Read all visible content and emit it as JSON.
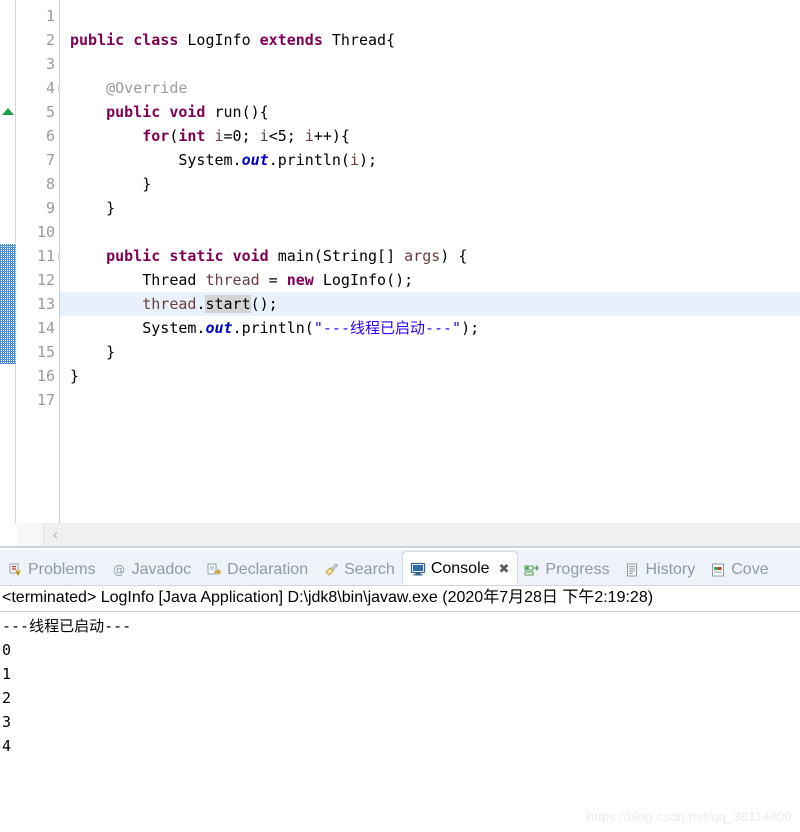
{
  "editor": {
    "line_numbers": [
      "1",
      "2",
      "3",
      "4",
      "5",
      "6",
      "7",
      "8",
      "9",
      "10",
      "11",
      "12",
      "13",
      "14",
      "15",
      "16",
      "17"
    ],
    "fold_lines": [
      4,
      11
    ],
    "marker_arrow_line": 5,
    "overview_hatch_lines": [
      11,
      12,
      13,
      14,
      15
    ],
    "highlighted_line": 13,
    "lines": [
      {
        "n": 1,
        "segments": []
      },
      {
        "n": 2,
        "segments": [
          {
            "t": "public ",
            "c": "kw"
          },
          {
            "t": "class ",
            "c": "kw"
          },
          {
            "t": "LogInfo ",
            "c": ""
          },
          {
            "t": "extends ",
            "c": "kw"
          },
          {
            "t": "Thread{",
            "c": ""
          }
        ]
      },
      {
        "n": 3,
        "segments": []
      },
      {
        "n": 4,
        "segments": [
          {
            "t": "    @Override",
            "c": "ann"
          }
        ]
      },
      {
        "n": 5,
        "segments": [
          {
            "t": "    ",
            "c": ""
          },
          {
            "t": "public ",
            "c": "kw"
          },
          {
            "t": "void ",
            "c": "kw"
          },
          {
            "t": "run(){",
            "c": ""
          }
        ]
      },
      {
        "n": 6,
        "segments": [
          {
            "t": "        ",
            "c": ""
          },
          {
            "t": "for",
            "c": "kw"
          },
          {
            "t": "(",
            "c": ""
          },
          {
            "t": "int ",
            "c": "kw"
          },
          {
            "t": "i",
            "c": "loc"
          },
          {
            "t": "=0; ",
            "c": ""
          },
          {
            "t": "i",
            "c": "loc"
          },
          {
            "t": "<5; ",
            "c": ""
          },
          {
            "t": "i",
            "c": "loc"
          },
          {
            "t": "++){",
            "c": ""
          }
        ]
      },
      {
        "n": 7,
        "segments": [
          {
            "t": "            System.",
            "c": ""
          },
          {
            "t": "out",
            "c": "fld"
          },
          {
            "t": ".println(",
            "c": ""
          },
          {
            "t": "i",
            "c": "loc"
          },
          {
            "t": ");",
            "c": ""
          }
        ]
      },
      {
        "n": 8,
        "segments": [
          {
            "t": "        }",
            "c": ""
          }
        ]
      },
      {
        "n": 9,
        "segments": [
          {
            "t": "    }",
            "c": ""
          }
        ]
      },
      {
        "n": 10,
        "segments": []
      },
      {
        "n": 11,
        "segments": [
          {
            "t": "    ",
            "c": ""
          },
          {
            "t": "public ",
            "c": "kw"
          },
          {
            "t": "static ",
            "c": "kw"
          },
          {
            "t": "void ",
            "c": "kw"
          },
          {
            "t": "main(String[] ",
            "c": ""
          },
          {
            "t": "args",
            "c": "loc"
          },
          {
            "t": ") {",
            "c": ""
          }
        ]
      },
      {
        "n": 12,
        "segments": [
          {
            "t": "        Thread ",
            "c": ""
          },
          {
            "t": "thread",
            "c": "loc"
          },
          {
            "t": " = ",
            "c": ""
          },
          {
            "t": "new ",
            "c": "kw"
          },
          {
            "t": "LogInfo();",
            "c": ""
          }
        ]
      },
      {
        "n": 13,
        "segments": [
          {
            "t": "        ",
            "c": ""
          },
          {
            "t": "thread",
            "c": "loc"
          },
          {
            "t": ".",
            "c": ""
          },
          {
            "t": "start",
            "c": "sel"
          },
          {
            "t": "();",
            "c": ""
          }
        ]
      },
      {
        "n": 14,
        "segments": [
          {
            "t": "        System.",
            "c": ""
          },
          {
            "t": "out",
            "c": "fld"
          },
          {
            "t": ".println(",
            "c": ""
          },
          {
            "t": "\"---线程已启动---\"",
            "c": "str"
          },
          {
            "t": ");",
            "c": ""
          }
        ]
      },
      {
        "n": 15,
        "segments": [
          {
            "t": "    }",
            "c": ""
          }
        ]
      },
      {
        "n": 16,
        "segments": [
          {
            "t": "}",
            "c": ""
          }
        ]
      },
      {
        "n": 17,
        "segments": []
      }
    ],
    "scroll_left_chevron": "‹"
  },
  "view_tabs": [
    {
      "label": "Problems",
      "icon": "problems-icon",
      "active": false,
      "closable": false
    },
    {
      "label": "Javadoc",
      "icon": "javadoc-icon",
      "active": false,
      "closable": false
    },
    {
      "label": "Declaration",
      "icon": "declaration-icon",
      "active": false,
      "closable": false
    },
    {
      "label": "Search",
      "icon": "search-icon",
      "active": false,
      "closable": false
    },
    {
      "label": "Console",
      "icon": "console-icon",
      "active": true,
      "closable": true,
      "close_glyph": "✖"
    },
    {
      "label": "Progress",
      "icon": "progress-icon",
      "active": false,
      "closable": false
    },
    {
      "label": "History",
      "icon": "history-icon",
      "active": false,
      "closable": false
    },
    {
      "label": "Cove",
      "icon": "coverage-icon",
      "active": false,
      "closable": false
    }
  ],
  "console": {
    "header": "<terminated> LogInfo [Java Application] D:\\jdk8\\bin\\javaw.exe (2020年7月28日 下午2:19:28)",
    "output": [
      "---线程已启动---",
      "0",
      "1",
      "2",
      "3",
      "4"
    ]
  },
  "watermark": "https://blog.csdn.net/qq_38114800",
  "colors": {
    "keyword": "#7f0055",
    "string": "#2a00ff",
    "annotation": "#9b9b9b",
    "field": "#0000c0",
    "local_var": "#6a3e3e",
    "line_highlight": "#e8f0fc",
    "selection": "#d4d4d4",
    "marker_blue": "#2f7fd0",
    "marker_green": "#1a9e4b",
    "tabbar_bg": "#eef2f9"
  }
}
